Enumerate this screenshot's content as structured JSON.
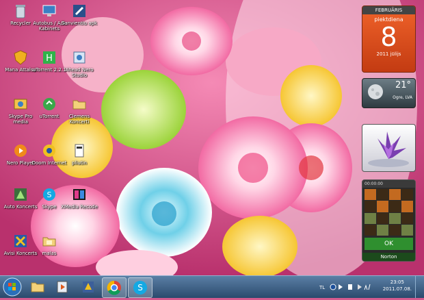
{
  "desktop_icons": [
    {
      "name": "recycle-bin",
      "label": "Recycler",
      "icon": "recycle-bin-icon"
    },
    {
      "name": "item-1",
      "label": "Autobus / A/A Kabinets",
      "icon": "computer-icon"
    },
    {
      "name": "item-2",
      "label": "Sanvientiu apk",
      "icon": "tools-icon"
    },
    {
      "name": "item-3",
      "label": "Mana Attalsa",
      "icon": "shield-icon"
    },
    {
      "name": "item-4",
      "label": "uTorrent 2.2.1",
      "icon": "utorrent-icon"
    },
    {
      "name": "item-5",
      "label": "Ahead Nero Studio",
      "icon": "app-icon"
    },
    {
      "name": "item-6",
      "label": "Skype Pro media",
      "icon": "media-icon"
    },
    {
      "name": "item-7",
      "label": "uTorrent",
      "icon": "utorrent-icon"
    },
    {
      "name": "item-8",
      "label": "Clemens Koncerti",
      "icon": "folder-icon"
    },
    {
      "name": "item-9",
      "label": "Nero Player",
      "icon": "player-icon"
    },
    {
      "name": "item-10",
      "label": "Doom Internet",
      "icon": "app-icon"
    },
    {
      "name": "item-11",
      "label": "pliutin",
      "icon": "app-icon"
    },
    {
      "name": "item-12",
      "label": "Auto Koncerts",
      "icon": "app-icon"
    },
    {
      "name": "item-13",
      "label": "Skype",
      "icon": "skype-icon"
    },
    {
      "name": "item-14",
      "label": "XMedia Recode",
      "icon": "video-icon"
    },
    {
      "name": "item-15",
      "label": "Avisi Koncerts",
      "icon": "app-icon"
    },
    {
      "name": "item-16",
      "label": "malas",
      "icon": "folder-icon"
    }
  ],
  "gadgets": {
    "calendar": {
      "header": "FEBRUĀRIS",
      "day_name": "piektdiena",
      "day": "8",
      "month_year": "2011 jūlijs"
    },
    "weather": {
      "temp": "21°",
      "city": "Ogre, LVA"
    },
    "puzzle": {
      "top": "00:00:00",
      "ok": "OK",
      "brand": "Norton"
    }
  },
  "taskbar": {
    "items": [
      {
        "name": "explorer",
        "icon": "folder-icon"
      },
      {
        "name": "media-player",
        "icon": "media-icon"
      },
      {
        "name": "app",
        "icon": "app-icon"
      },
      {
        "name": "chrome",
        "icon": "chrome-icon"
      },
      {
        "name": "skype",
        "icon": "skype-icon"
      }
    ],
    "clock": {
      "time": "23:05",
      "date": "2011.07.08."
    }
  }
}
